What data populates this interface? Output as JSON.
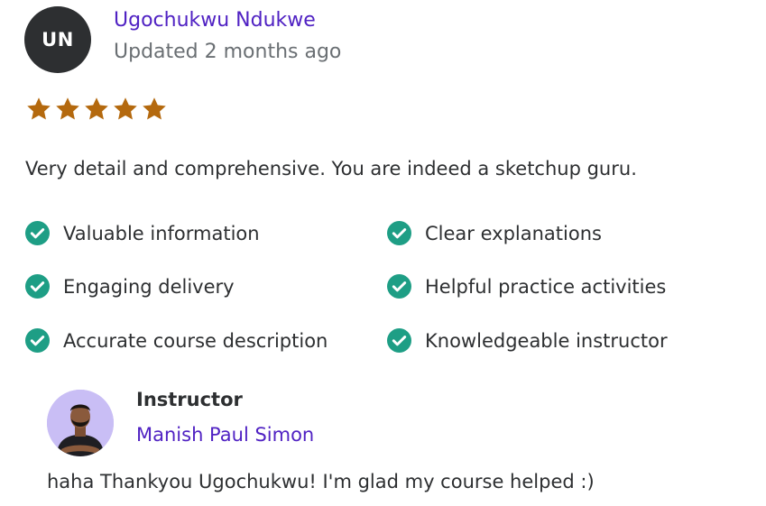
{
  "review": {
    "reviewer_initials": "UN",
    "reviewer_name": "Ugochukwu Ndukwe",
    "updated": "Updated 2 months ago",
    "rating": 5,
    "rating_max": 5,
    "text": "Very detail and comprehensive. You are indeed a sketchup guru.",
    "highlights": [
      "Valuable information",
      "Clear explanations",
      "Engaging delivery",
      "Helpful practice activities",
      "Accurate course description",
      "Knowledgeable instructor"
    ]
  },
  "reply": {
    "role": "Instructor",
    "name": "Manish Paul Simon",
    "text": "haha Thankyou Ugochukwu! I'm glad my course helped :)"
  },
  "colors": {
    "star": "#b4690e",
    "check": "#1e9e85",
    "link": "#5022c3",
    "avatar_bg": "#2d2f31",
    "muted": "#6a6f73"
  },
  "icons": {
    "star": "star-icon",
    "check": "check-circle-icon",
    "instructor_photo": "instructor-avatar-photo"
  }
}
